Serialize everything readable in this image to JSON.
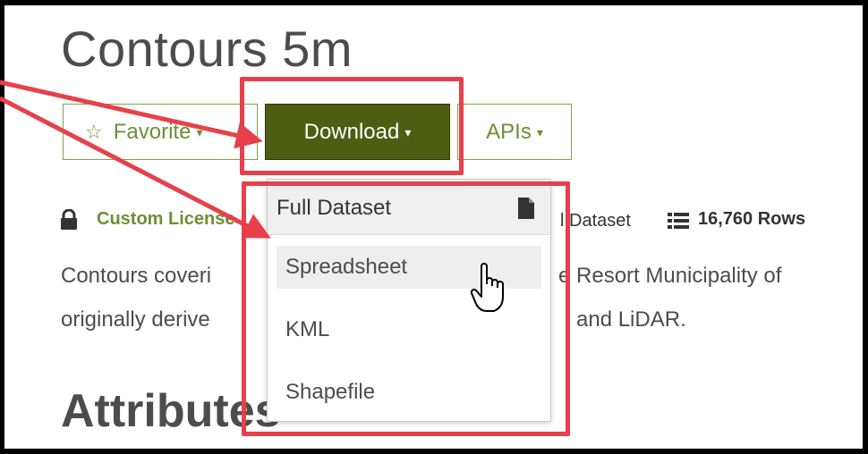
{
  "page": {
    "title": "Contours 5m",
    "attributes_heading": "Attributes"
  },
  "toolbar": {
    "favorite_label": "Favorite",
    "download_label": "Download",
    "apis_label": "APIs",
    "caret": "▾"
  },
  "meta": {
    "license_label": "Custom License",
    "dataset_type": "l Dataset",
    "rows_count": "16,760 Rows"
  },
  "description": {
    "line1_left": "Contours coveri",
    "line1_right": "e Resort Municipality of",
    "line2_left": "originally derive",
    "line2_right": "and LiDAR."
  },
  "download_menu": {
    "header_label": "Full Dataset",
    "items": [
      {
        "label": "Spreadsheet"
      },
      {
        "label": "KML"
      },
      {
        "label": "Shapefile"
      }
    ]
  },
  "colors": {
    "accent_green": "#6e8f36",
    "download_bg": "#4d5d12",
    "highlight_red": "#e8404a"
  },
  "icons": {
    "favorite": "star-icon",
    "license": "lock-icon",
    "rows": "list-icon",
    "dataset": "file-icon",
    "cursor": "hand-pointer-icon"
  }
}
